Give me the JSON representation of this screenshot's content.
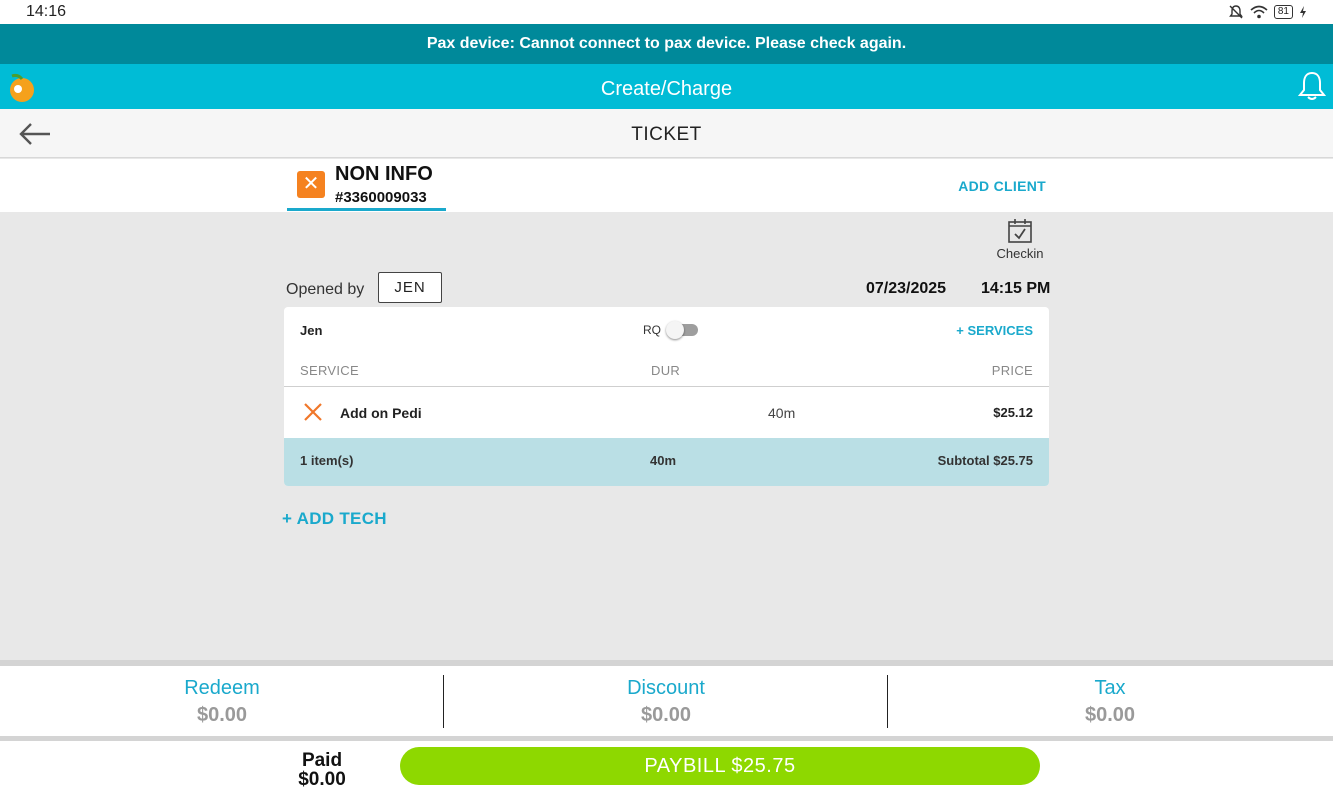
{
  "status_bar": {
    "time": "14:16",
    "battery": "81",
    "icons": [
      "silent-icon",
      "wifi-icon",
      "battery-icon",
      "charging-icon"
    ]
  },
  "alert": {
    "message": "Pax device: Cannot connect to pax device. Please check again."
  },
  "app_bar": {
    "title": "Create/Charge",
    "icons": [
      "logo-icon",
      "bell-icon"
    ]
  },
  "ticket_bar": {
    "title": "TICKET",
    "icons": [
      "back-arrow-icon"
    ]
  },
  "client": {
    "name": "NON INFO",
    "number": "#3360009033",
    "add_client_label": "ADD CLIENT"
  },
  "checkin": {
    "label": "Checkin"
  },
  "meta": {
    "opened_by_label": "Opened by",
    "opened_by": "JEN",
    "date": "07/23/2025",
    "time": "14:15 PM"
  },
  "tech_card": {
    "tech_name": "Jen",
    "rq_label": "RQ",
    "rq_enabled": false,
    "add_services_label": "+ SERVICES",
    "columns": {
      "service": "SERVICE",
      "dur": "DUR",
      "price": "PRICE"
    },
    "services": [
      {
        "name": "Add on Pedi",
        "dur": "40m",
        "price": "$25.12"
      }
    ],
    "footer": {
      "items": "1 item(s)",
      "dur": "40m",
      "subtotal": "Subtotal $25.75"
    }
  },
  "add_tech_label": "+ ADD TECH",
  "summary": {
    "redeem": {
      "label": "Redeem",
      "value": "$0.00"
    },
    "discount": {
      "label": "Discount",
      "value": "$0.00"
    },
    "tax": {
      "label": "Tax",
      "value": "$0.00"
    }
  },
  "payment": {
    "paid_label": "Paid",
    "paid_value": "$0.00",
    "paybill_label": "PAYBILL $25.75"
  },
  "colors": {
    "alert": "#00899a",
    "app_bar": "#00bcd6",
    "accent": "#1aa9cc",
    "remove": "#f58220",
    "pay": "#8ed800",
    "footer_row": "#badfe5"
  }
}
